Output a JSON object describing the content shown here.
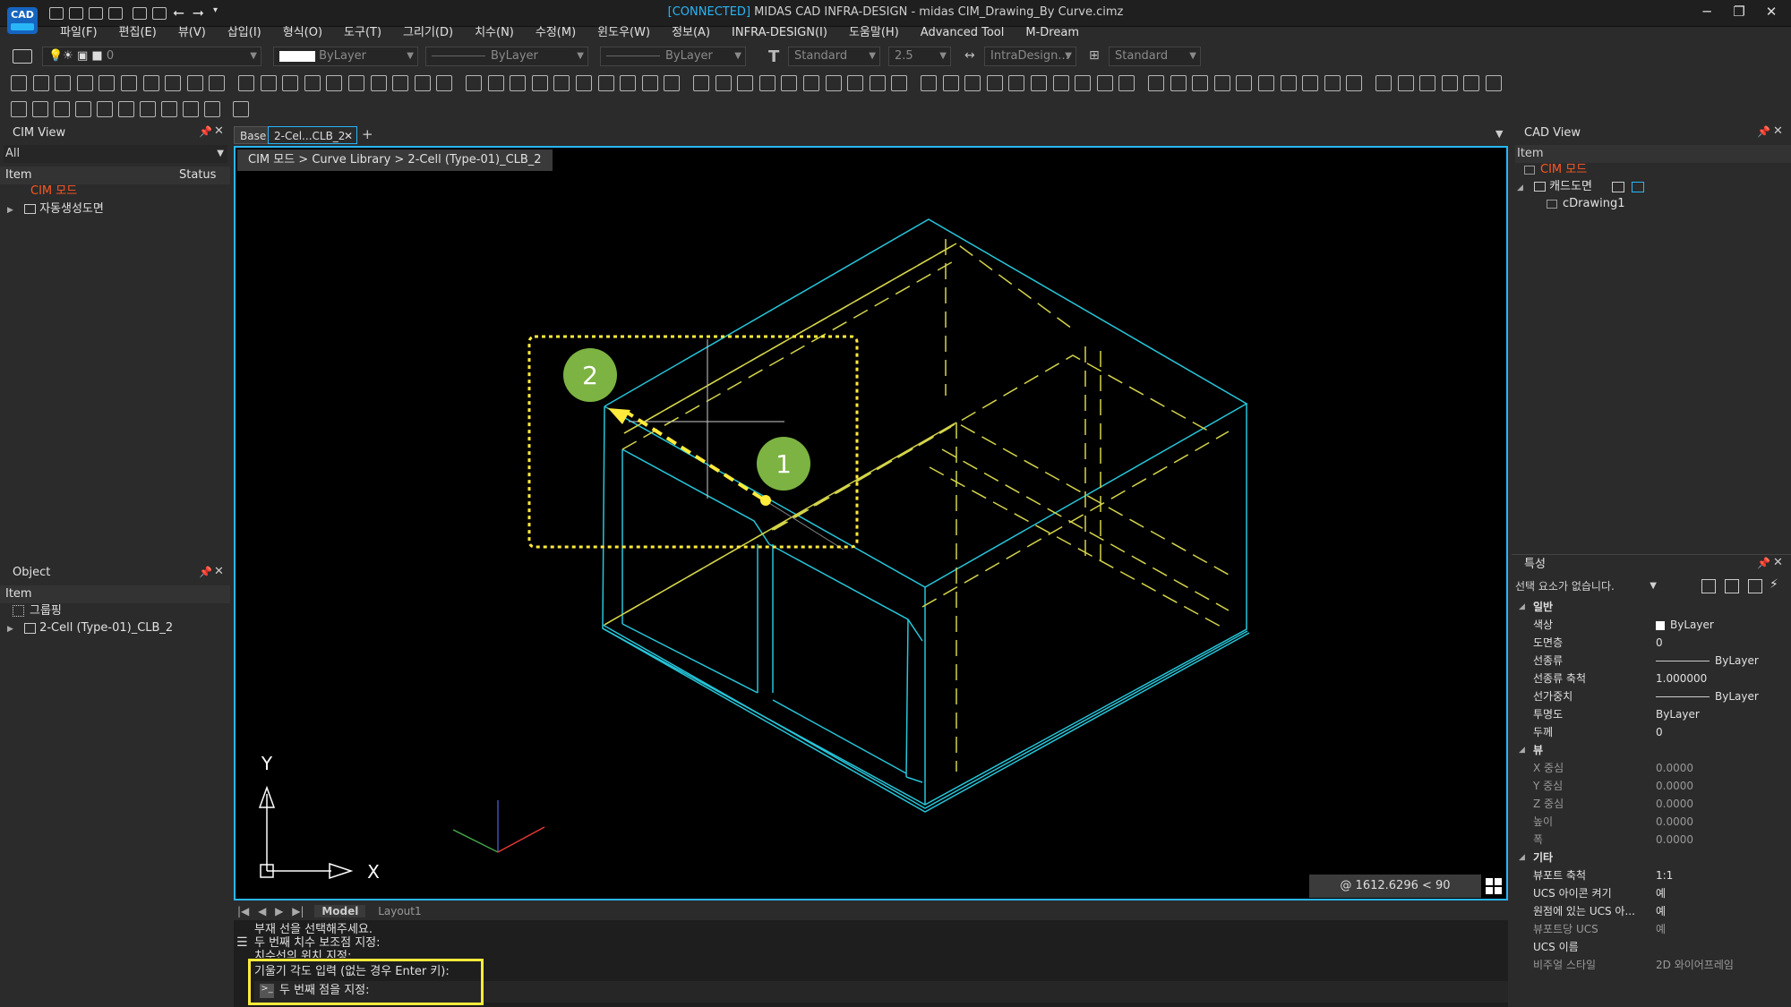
{
  "window": {
    "connected": "[CONNECTED]",
    "title": " MIDAS CAD INFRA-DESIGN - midas CIM_Drawing_By Curve.cimz",
    "minimize": "─",
    "restore": "❐",
    "close": "✕"
  },
  "logo": {
    "text": "CAD"
  },
  "menu": [
    "파일(F)",
    "편집(E)",
    "뷰(V)",
    "삽입(I)",
    "형식(O)",
    "도구(T)",
    "그리기(D)",
    "치수(N)",
    "수정(M)",
    "윈도우(W)",
    "정보(A)",
    "INFRA-DESIGN(I)",
    "도움말(H)",
    "Advanced Tool",
    "M-Dream"
  ],
  "toolbar_combos": {
    "layer": "0",
    "color": "ByLayer",
    "linetype": "ByLayer",
    "lineweight": "ByLayer",
    "text_style": "Standard",
    "text_height": "2.5",
    "dim_style": "IntraDesign...",
    "table_style": "Standard"
  },
  "cim_view": {
    "title": "CIM View",
    "filter": "All",
    "col_item": "Item",
    "col_status": "Status",
    "root": "CIM 모드",
    "child": "자동생성도면"
  },
  "object_panel": {
    "title": "Object",
    "col_item": "Item",
    "group": "그룹핑",
    "child": "2-Cell (Type-01)_CLB_2"
  },
  "tabs": [
    "Base",
    "2-Cel...CLB_2"
  ],
  "tab_add": "+",
  "breadcrumb": "CIM 모드 > Curve Library > 2-Cell (Type-01)_CLB_2",
  "markers": {
    "m1": "1",
    "m2": "2"
  },
  "axes": {
    "x": "X",
    "y": "Y"
  },
  "coordinate_readout": "@ 1612.6296 < 90",
  "layout_tabs": {
    "model": "Model",
    "layout": "Layout1"
  },
  "command_history": [
    "부재 선을 선택해주세요.",
    "두 번째 치수 보조점 지정:",
    "치수선의 위치 지정:"
  ],
  "command_prompt": "기울기 각도 입력 (없는 경우 Enter 키):",
  "command_input_label": "두 번째 점을 지정:",
  "cad_view": {
    "title": "CAD View",
    "col_item": "Item",
    "root": "CIM 모드",
    "node": "캐드도면",
    "leaf": "cDrawing1"
  },
  "properties": {
    "title": "특성",
    "selection": "선택 요소가 없습니다.",
    "sections": [
      {
        "name": "일반",
        "rows": [
          {
            "name": "색상",
            "value": "ByLayer",
            "swatch": "#ffffff"
          },
          {
            "name": "도면층",
            "value": "0"
          },
          {
            "name": "선종류",
            "value": "ByLayer",
            "line": true
          },
          {
            "name": "선종류 축척",
            "value": "1.000000"
          },
          {
            "name": "선가중치",
            "value": "ByLayer",
            "line": true
          },
          {
            "name": "투명도",
            "value": "ByLayer"
          },
          {
            "name": "두께",
            "value": "0"
          }
        ]
      },
      {
        "name": "뷰",
        "rows": [
          {
            "name": "X 중심",
            "value": "0.0000",
            "dim": true
          },
          {
            "name": "Y 중심",
            "value": "0.0000",
            "dim": true
          },
          {
            "name": "Z 중심",
            "value": "0.0000",
            "dim": true
          },
          {
            "name": "높이",
            "value": "0.0000",
            "dim": true
          },
          {
            "name": "폭",
            "value": "0.0000",
            "dim": true
          }
        ]
      },
      {
        "name": "기타",
        "rows": [
          {
            "name": "뷰포트 축척",
            "value": "1:1"
          },
          {
            "name": "UCS 아이콘 켜기",
            "value": "예"
          },
          {
            "name": "원점에 있는 UCS 아...",
            "value": "예"
          },
          {
            "name": "뷰포트당 UCS",
            "value": "예",
            "dim": true
          },
          {
            "name": "UCS 이름",
            "value": ""
          },
          {
            "name": "비주얼 스타일",
            "value": "2D 와이어프레임",
            "dim": true
          }
        ]
      }
    ]
  },
  "colors": {
    "accent": "#29b6f6",
    "model_cyan": "#26c6da",
    "model_yellow": "#d4d44a",
    "highlight_yellow": "#ffeb3b",
    "marker_green": "#7cb342",
    "tree_root_orange": "#ff5722"
  }
}
